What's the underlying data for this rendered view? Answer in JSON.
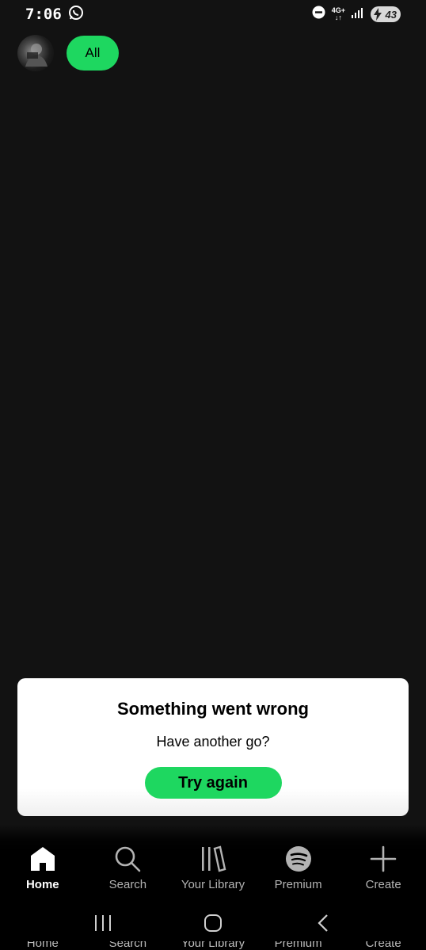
{
  "status_bar": {
    "time": "7:06",
    "network": "4G+",
    "battery": "43"
  },
  "filters": {
    "all_label": "All"
  },
  "error": {
    "title": "Something went wrong",
    "subtitle": "Have another go?",
    "button_label": "Try again"
  },
  "nav": {
    "items": [
      {
        "label": "Home",
        "icon": "home-icon",
        "active": true
      },
      {
        "label": "Search",
        "icon": "search-icon",
        "active": false
      },
      {
        "label": "Your Library",
        "icon": "library-icon",
        "active": false
      },
      {
        "label": "Premium",
        "icon": "spotify-icon",
        "active": false
      },
      {
        "label": "Create",
        "icon": "plus-icon",
        "active": false
      }
    ]
  },
  "colors": {
    "accent": "#1ed760",
    "background": "#121212"
  }
}
